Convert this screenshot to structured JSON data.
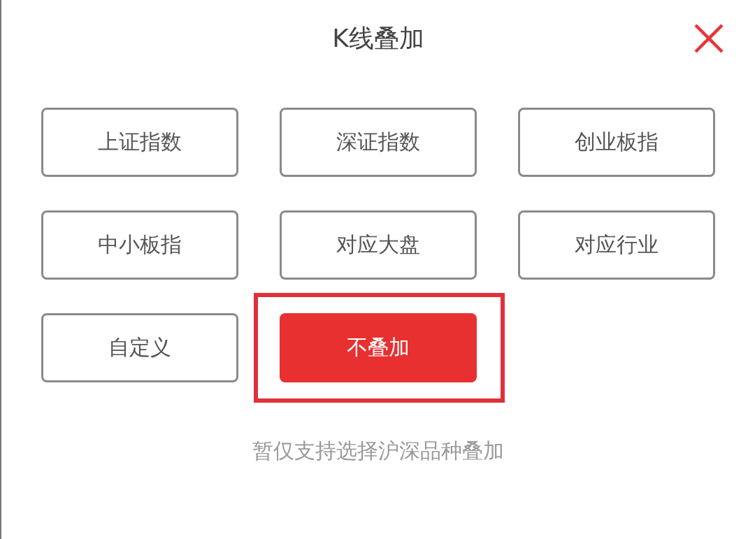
{
  "dialog": {
    "title": "K线叠加"
  },
  "buttons": [
    {
      "label": "上证指数",
      "selected": false,
      "highlighted": false
    },
    {
      "label": "深证指数",
      "selected": false,
      "highlighted": false
    },
    {
      "label": "创业板指",
      "selected": false,
      "highlighted": false
    },
    {
      "label": "中小板指",
      "selected": false,
      "highlighted": false
    },
    {
      "label": "对应大盘",
      "selected": false,
      "highlighted": false
    },
    {
      "label": "对应行业",
      "selected": false,
      "highlighted": false
    },
    {
      "label": "自定义",
      "selected": false,
      "highlighted": false
    },
    {
      "label": "不叠加",
      "selected": true,
      "highlighted": true
    }
  ],
  "note": "暂仅支持选择沪深品种叠加"
}
